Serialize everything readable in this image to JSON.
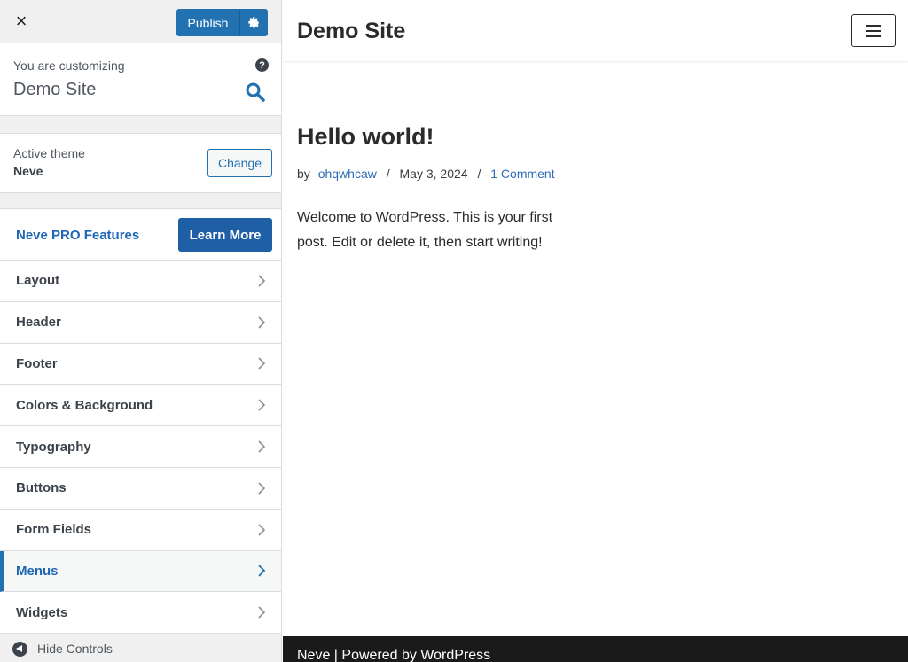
{
  "sidebar": {
    "close_label": "×",
    "publish_label": "Publish",
    "customizing_label": "You are customizing",
    "site_title": "Demo Site",
    "help_label": "?",
    "active_theme_label": "Active theme",
    "theme_name": "Neve",
    "change_label": "Change",
    "pro_features_label": "Neve PRO Features",
    "learn_more_label": "Learn More",
    "menu_items": [
      {
        "label": "Layout",
        "active": false
      },
      {
        "label": "Header",
        "active": false
      },
      {
        "label": "Footer",
        "active": false
      },
      {
        "label": "Colors & Background",
        "active": false
      },
      {
        "label": "Typography",
        "active": false
      },
      {
        "label": "Buttons",
        "active": false
      },
      {
        "label": "Form Fields",
        "active": false
      },
      {
        "label": "Menus",
        "active": true
      },
      {
        "label": "Widgets",
        "active": false
      }
    ],
    "hide_controls_label": "Hide Controls"
  },
  "preview": {
    "site_title": "Demo Site",
    "post_title": "Hello world!",
    "meta": {
      "by": "by",
      "author": "ohqwhcaw",
      "sep": "/",
      "date": "May 3, 2024",
      "comments": "1 Comment"
    },
    "excerpt": "Welcome to WordPress. This is your first post. Edit or delete it, then start writing!",
    "footer_text": "Neve | Powered by WordPress"
  },
  "colors": {
    "accent": "#2271b1",
    "pro_blue": "#1e66b4",
    "footer_bg": "#1a1a1a"
  }
}
